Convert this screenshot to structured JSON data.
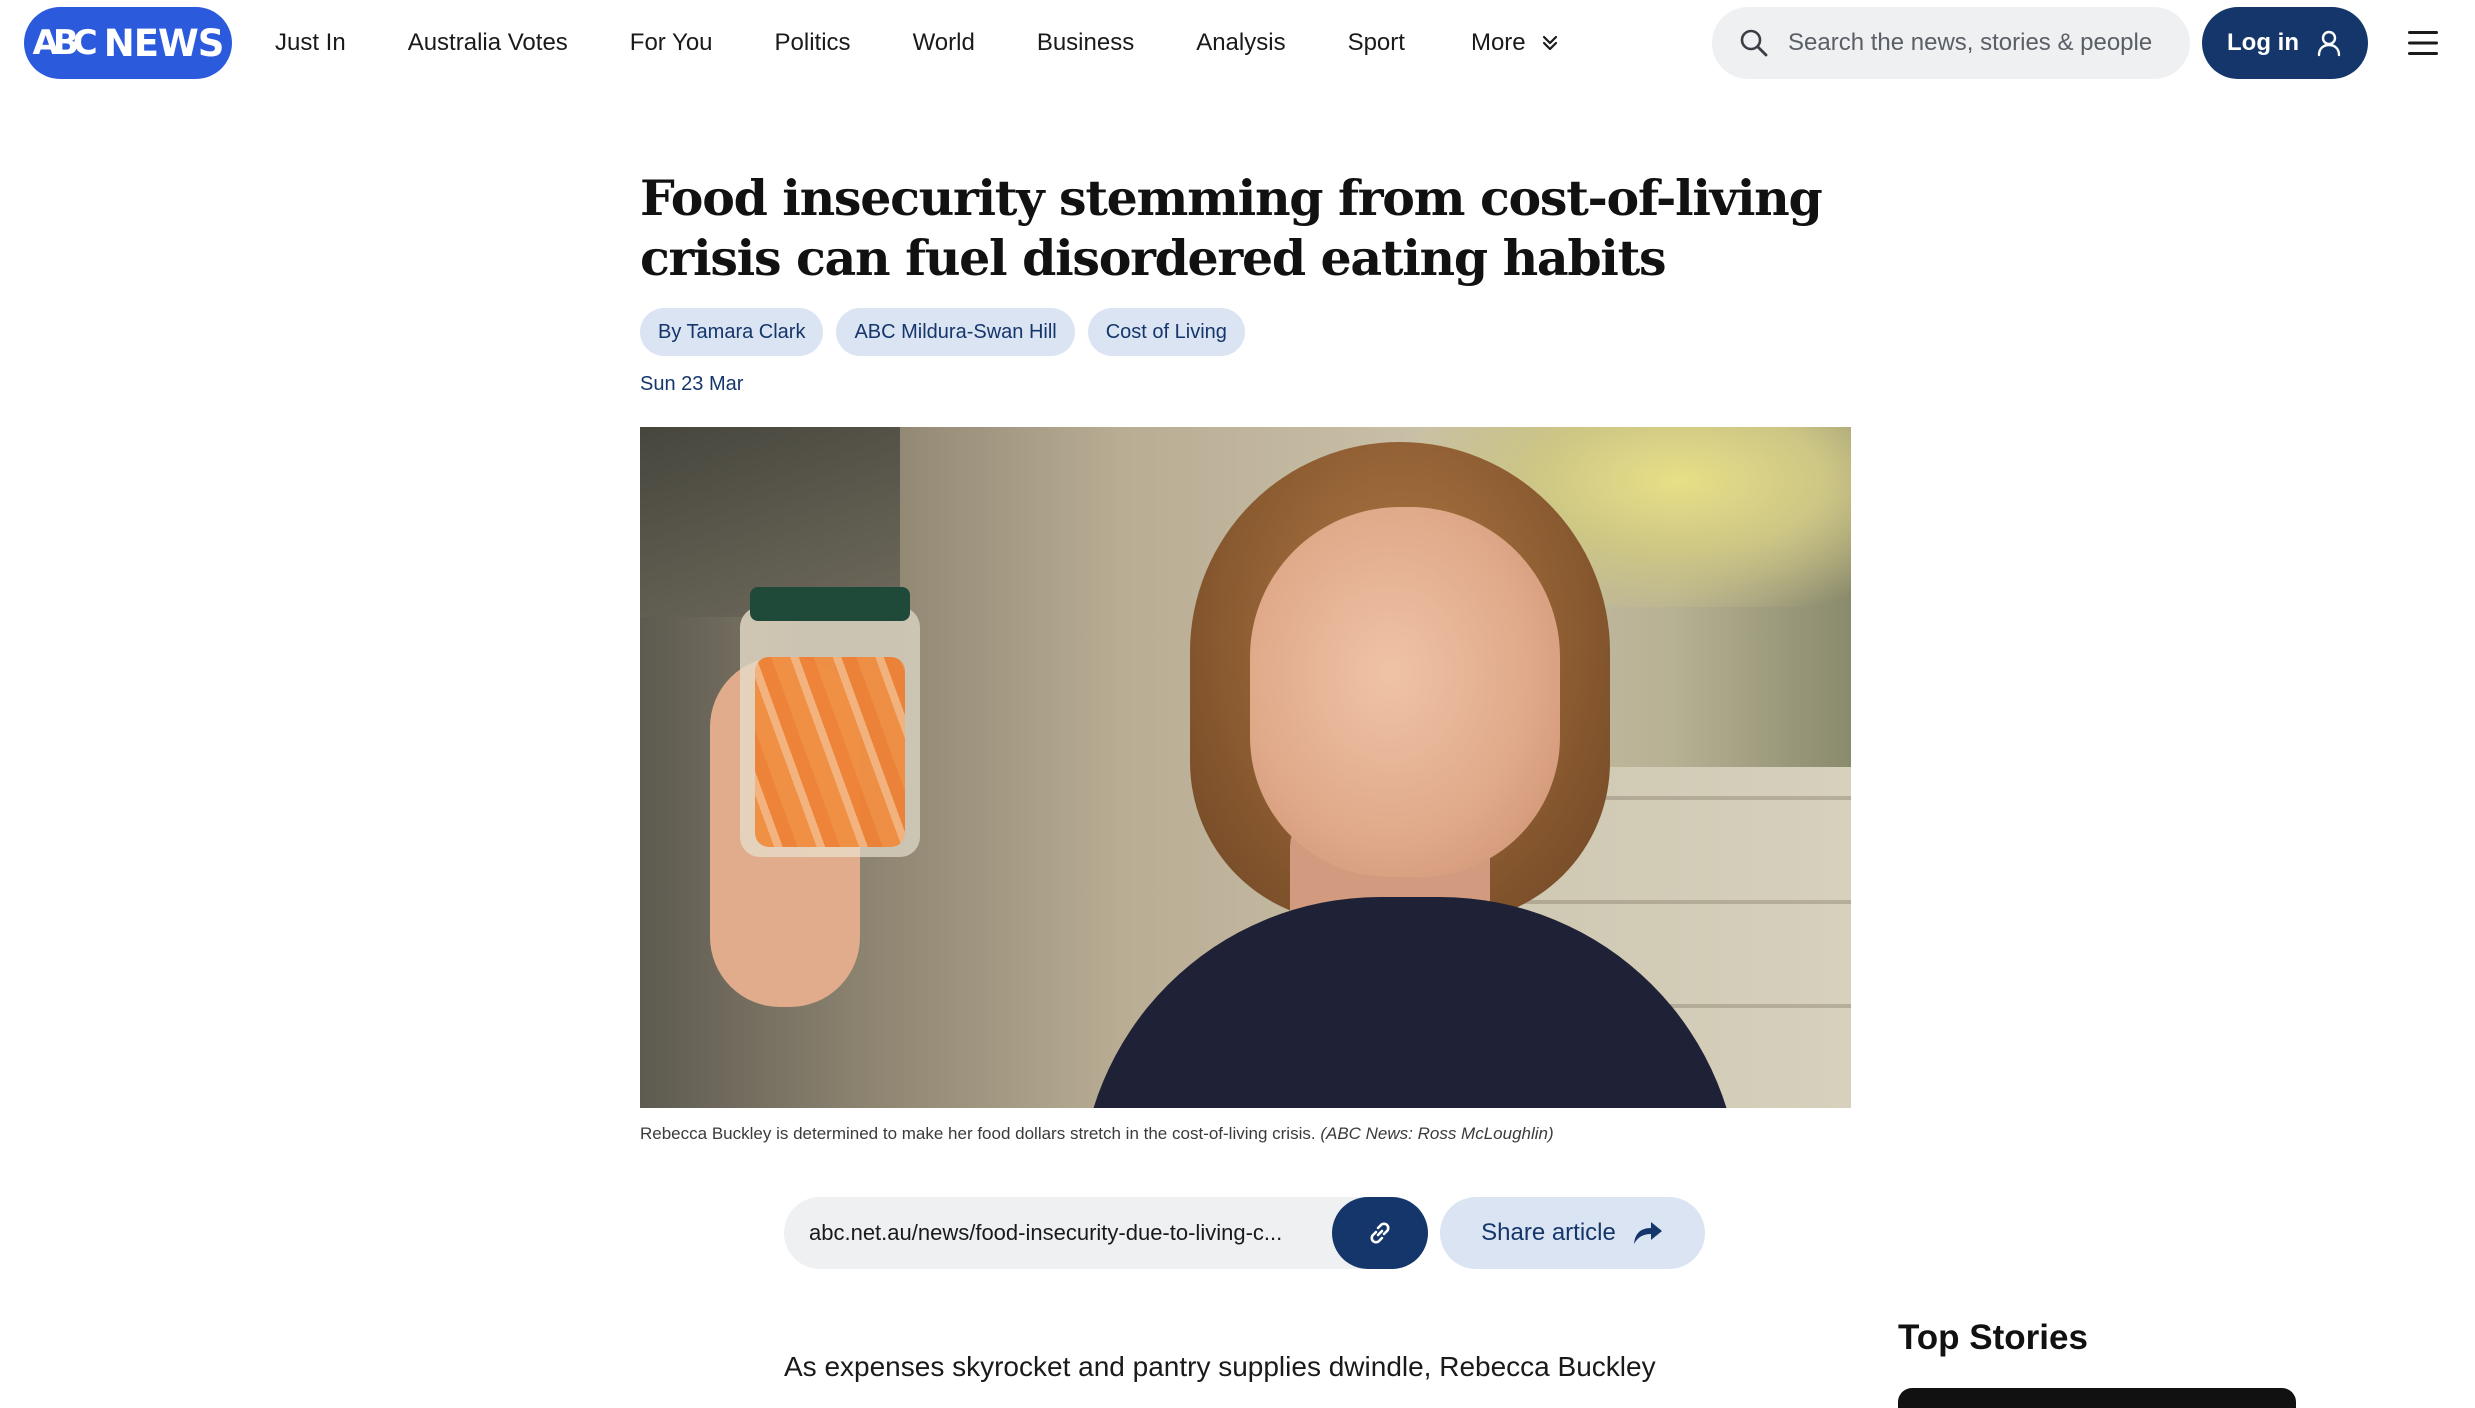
{
  "header": {
    "logo_mark": "ABC",
    "logo_text": "NEWS",
    "nav": [
      "Just In",
      "Australia Votes",
      "For You",
      "Politics",
      "World",
      "Business",
      "Analysis",
      "Sport"
    ],
    "more_label": "More",
    "search_placeholder": "Search the news, stories & people",
    "login_label": "Log in"
  },
  "article": {
    "headline": "Food insecurity stemming from cost-of-living crisis can fuel disordered eating habits",
    "tags": [
      "By Tamara Clark",
      "ABC Mildura-Swan Hill",
      "Cost of Living"
    ],
    "date": "Sun 23 Mar",
    "caption_text": "Rebecca Buckley is determined to make her food dollars stretch in the cost-of-living crisis.",
    "caption_credit": "(ABC News: Ross McLoughlin)",
    "share_url": "abc.net.au/news/food-insecurity-due-to-living-c...",
    "share_label": "Share article",
    "lede": "As expenses skyrocket and pantry supplies dwindle, Rebecca Buckley"
  },
  "sidebar": {
    "top_stories_title": "Top Stories"
  },
  "colors": {
    "brand_blue": "#2b5bdc",
    "navy": "#14366b",
    "tag_bg": "#dbe4f3",
    "search_bg": "#eef0f2"
  },
  "icons": {
    "search": "search-icon",
    "user": "user-icon",
    "menu": "hamburger-menu-icon",
    "link": "link-icon",
    "share": "share-arrow-icon",
    "chevron": "chevron-double-down-icon"
  }
}
